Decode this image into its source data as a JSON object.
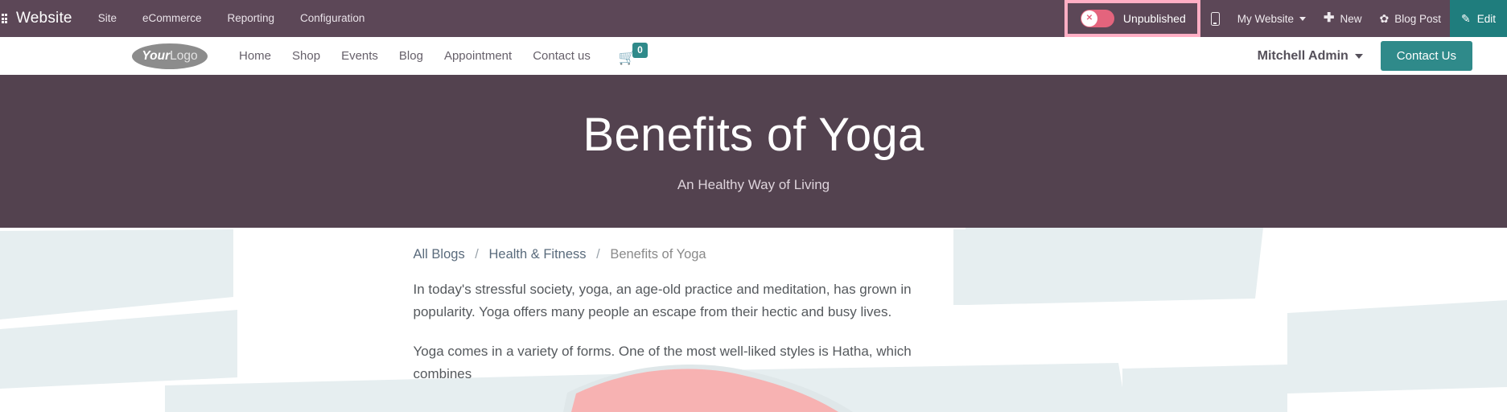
{
  "backend": {
    "apps_icon": "apps-grid-icon",
    "app_name": "Website",
    "menu": [
      {
        "label": "Site"
      },
      {
        "label": "eCommerce"
      },
      {
        "label": "Reporting"
      },
      {
        "label": "Configuration"
      }
    ],
    "publish": {
      "state": "Unpublished",
      "toggle_icon": "close-circle-icon",
      "highlight_color": "#ffaec4",
      "switch_color": "#e4647d"
    },
    "right_items": {
      "mobile_preview_icon": "mobile-phone-icon",
      "website_selector": "My Website",
      "new_icon": "plus-icon",
      "new_label": "New",
      "gear_icon": "gear-icon",
      "object_label": "Blog Post",
      "edit_icon": "pencil-icon",
      "edit_label": "Edit",
      "edit_color": "#1f7d7d"
    },
    "bar_color": "#5c4757"
  },
  "site_header": {
    "logo": {
      "bold": "Your",
      "light": "Logo"
    },
    "nav": [
      {
        "label": "Home"
      },
      {
        "label": "Shop"
      },
      {
        "label": "Events"
      },
      {
        "label": "Blog"
      },
      {
        "label": "Appointment"
      },
      {
        "label": "Contact us"
      }
    ],
    "cart": {
      "icon": "shopping-cart-icon",
      "count": "0",
      "badge_color": "#2f8a8a"
    },
    "user": "Mitchell Admin",
    "cta": {
      "label": "Contact Us",
      "color": "#2f8a8a"
    }
  },
  "hero": {
    "title": "Benefits of Yoga",
    "subtitle": "An Healthy Way of Living",
    "background_color": "#53424f"
  },
  "content": {
    "breadcrumb": [
      {
        "label": "All Blogs",
        "link": true
      },
      {
        "label": "Health & Fitness",
        "link": true
      },
      {
        "label": "Benefits of Yoga",
        "link": false
      }
    ],
    "separator": "/",
    "paragraphs": [
      "In today's stressful society, yoga, an age-old practice and meditation, has grown in popularity. Yoga offers many people an escape from their hectic and busy lives.",
      "Yoga comes in a variety of forms. One of the most well-liked styles is Hatha, which combines"
    ]
  }
}
